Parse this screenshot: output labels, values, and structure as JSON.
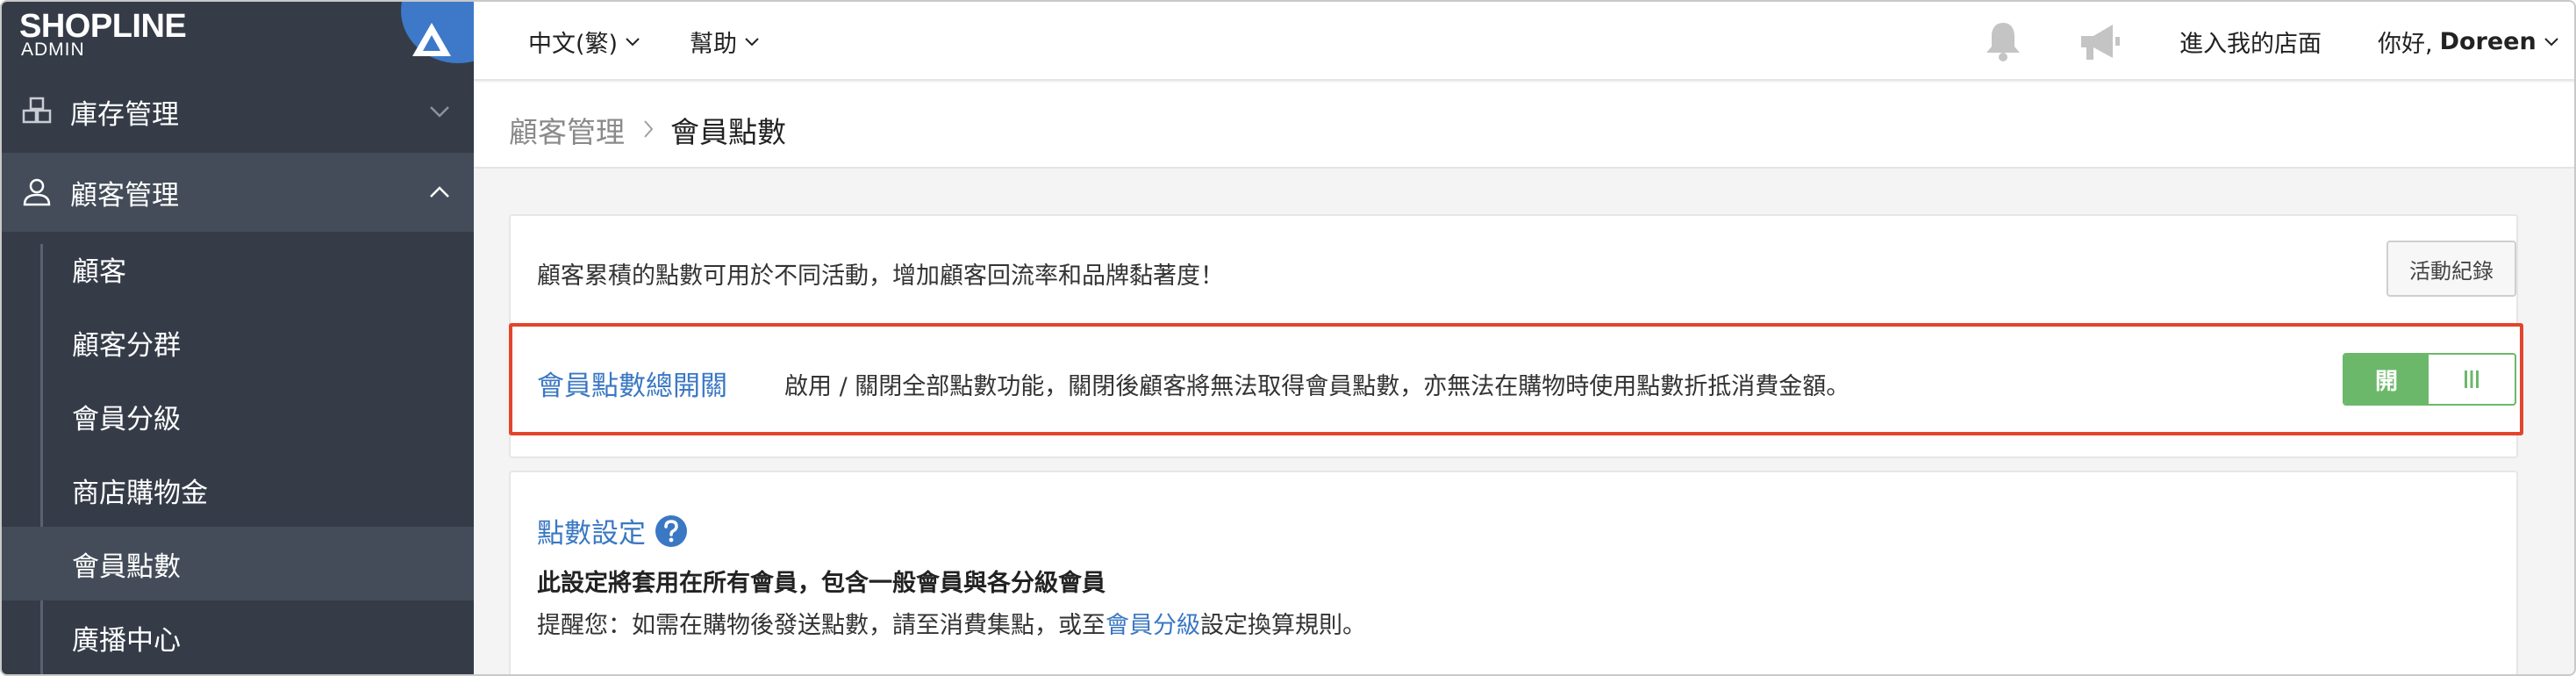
{
  "brand": {
    "logo": "SHOPLINE",
    "sub": "ADMIN"
  },
  "sidebar": {
    "stock": {
      "label": "庫存管理",
      "icon": "inventory-icon"
    },
    "customers": {
      "label": "顧客管理",
      "icon": "user-icon"
    },
    "sub_items": [
      {
        "label": "顧客"
      },
      {
        "label": "顧客分群"
      },
      {
        "label": "會員分級"
      },
      {
        "label": "商店購物金"
      },
      {
        "label": "會員點數",
        "active": true
      },
      {
        "label": "廣播中心"
      }
    ]
  },
  "topbar": {
    "language": "中文(繁)",
    "help": "幫助",
    "store_link": "進入我的店面",
    "greeting": "你好,",
    "user_name": "Doreen"
  },
  "breadcrumb": {
    "parent": "顧客管理",
    "current": "會員點數"
  },
  "intro": {
    "text": "顧客累積的點數可用於不同活動，增加顧客回流率和品牌黏著度！",
    "log_button": "活動紀錄"
  },
  "master_switch": {
    "title": "會員點數總開關",
    "description": "啟用 / 關閉全部點數功能，關閉後顧客將無法取得會員點數，亦無法在購物時使用點數折抵消費金額。",
    "on_label": "開",
    "state": "on"
  },
  "points_settings": {
    "title": "點數設定",
    "note": "此設定將套用在所有會員，包含一般會員與各分級會員",
    "reminder_prefix": "提醒您：如需在購物後發送點數，請至消費集點，或至",
    "reminder_link": "會員分級",
    "reminder_suffix": "設定換算規則。"
  },
  "colors": {
    "sidebar_bg": "#353c48",
    "accent_blue": "#3a78c3",
    "toggle_green": "#6cb86a",
    "highlight_red": "#e2452b"
  }
}
